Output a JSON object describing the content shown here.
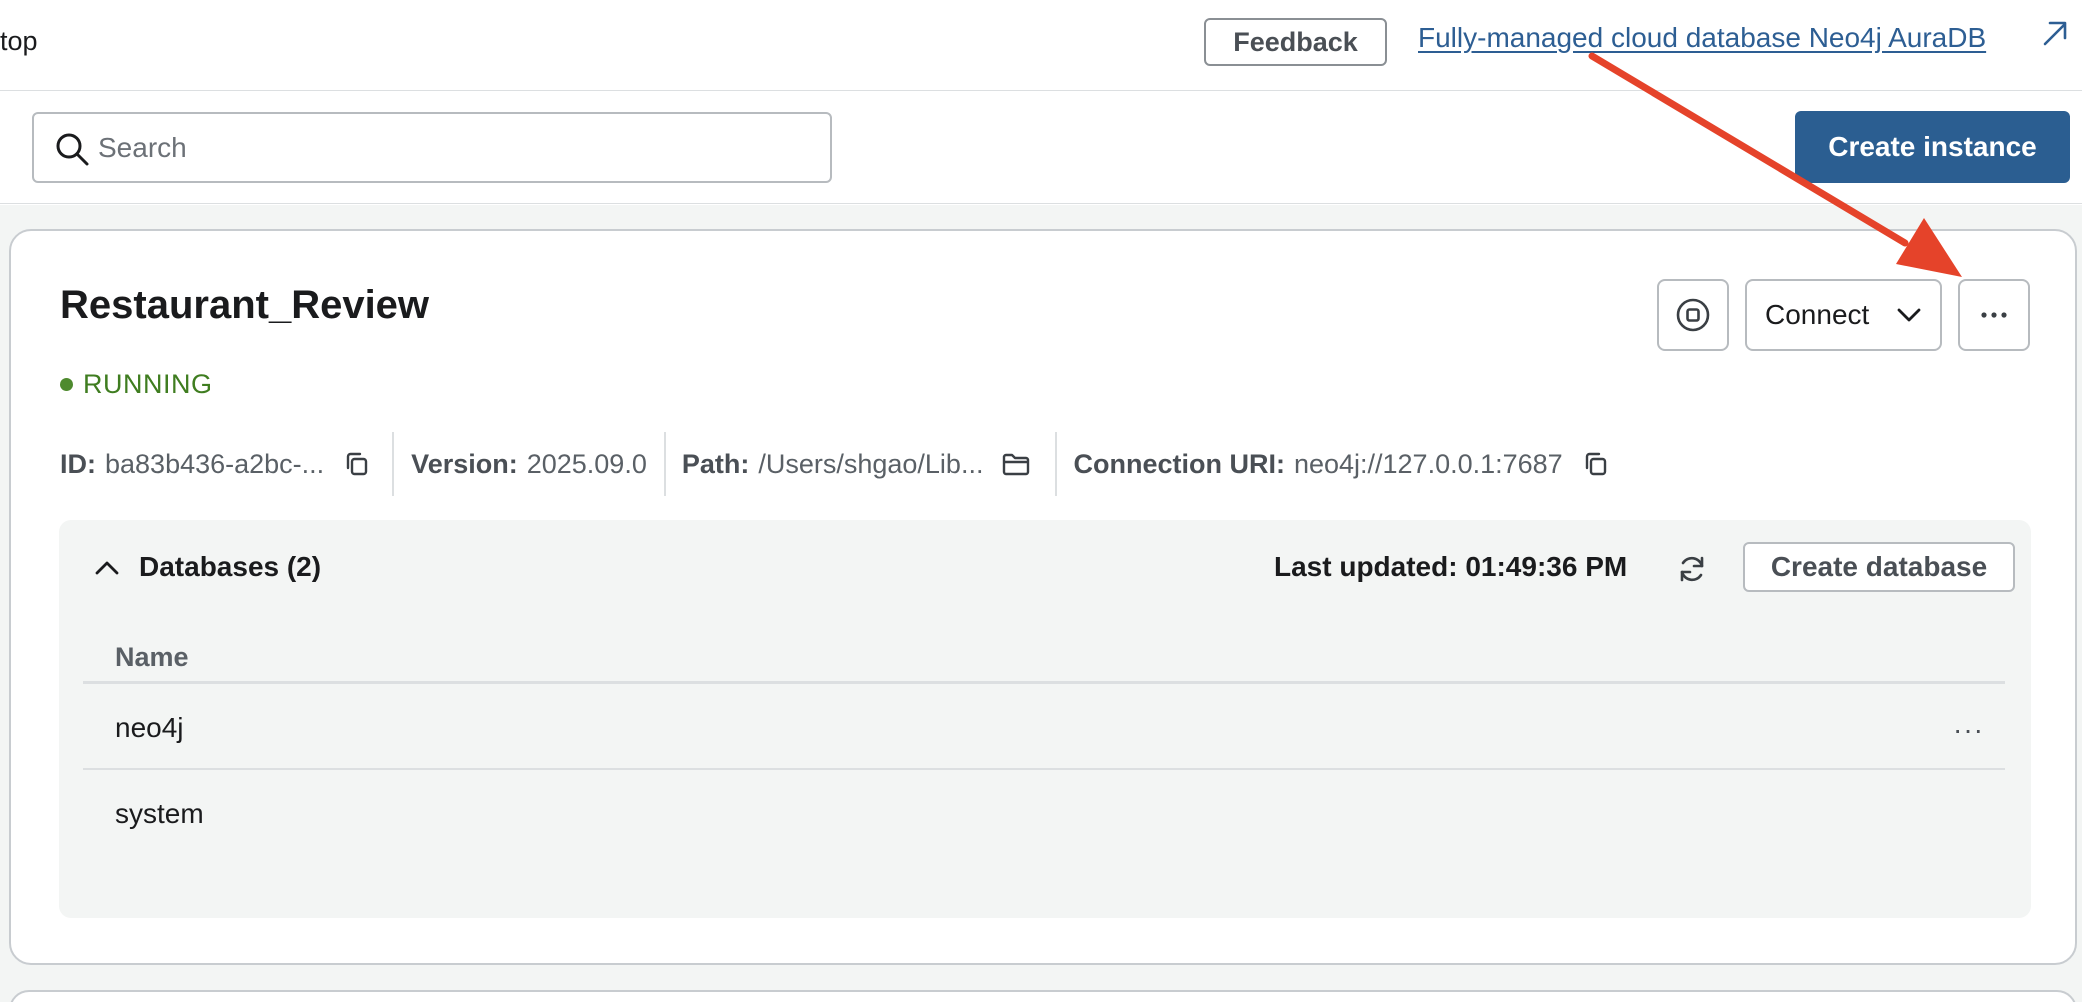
{
  "header": {
    "app_title_fragment": "top",
    "feedback_label": "Feedback",
    "aura_link_text": "Fully-managed cloud database Neo4j AuraDB"
  },
  "toolbar": {
    "search_placeholder": "Search",
    "create_instance_label": "Create instance"
  },
  "instance": {
    "name": "Restaurant_Review",
    "status": "RUNNING",
    "connect_label": "Connect",
    "meta": {
      "id_label": "ID:",
      "id_value": "ba83b436-a2bc-...",
      "version_label": "Version:",
      "version_value": "2025.09.0",
      "path_label": "Path:",
      "path_value": "/Users/shgao/Lib...",
      "uri_label": "Connection URI:",
      "uri_value": "neo4j://127.0.0.1:7687"
    },
    "databases": {
      "title": "Databases (2)",
      "last_updated": "Last updated: 01:49:36 PM",
      "create_label": "Create database",
      "column_name": "Name",
      "rows": [
        {
          "name": "neo4j",
          "more": "···"
        },
        {
          "name": "system"
        }
      ]
    }
  },
  "colors": {
    "primary": "#2b5e91",
    "link": "#2d5e93",
    "running": "#3f7d20",
    "annotation_arrow": "#e5432a"
  },
  "icons": [
    "external-link-icon",
    "search-icon",
    "stop-icon",
    "chevron-down-icon",
    "more-horizontal-icon",
    "copy-icon",
    "folder-icon",
    "chevron-up-icon",
    "refresh-icon"
  ]
}
